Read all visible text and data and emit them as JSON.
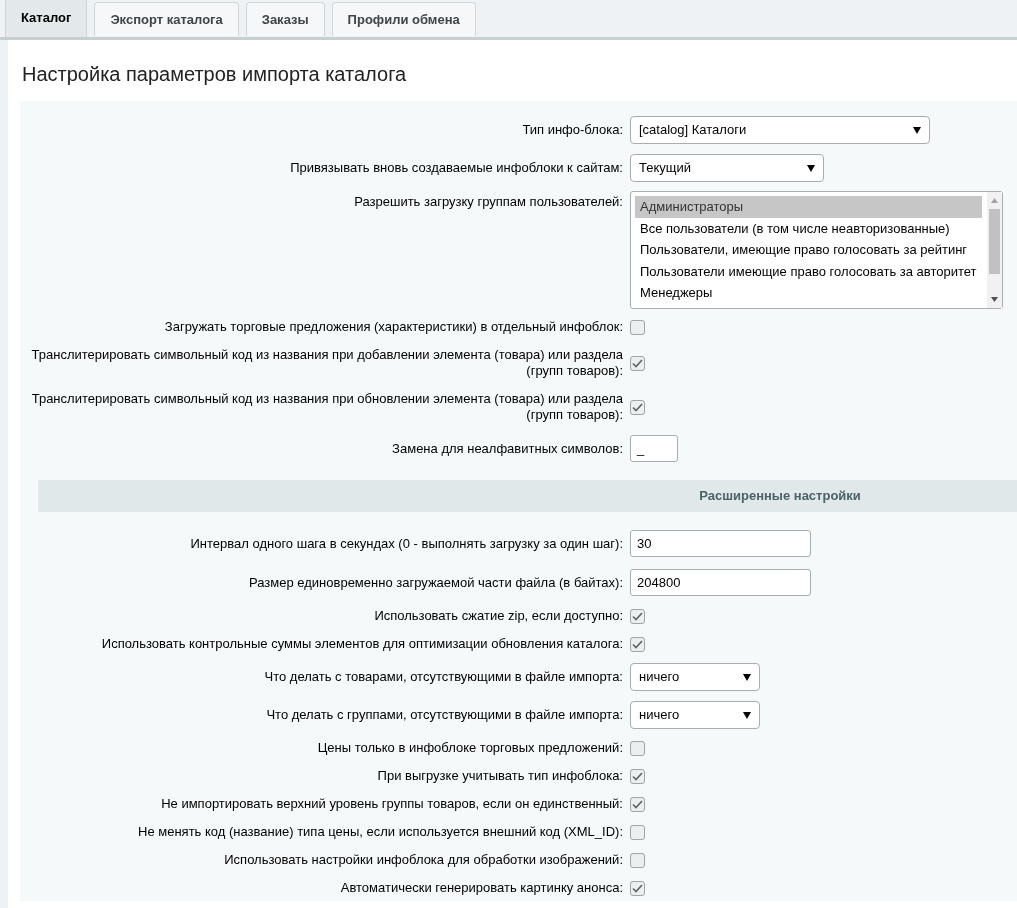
{
  "tabs": [
    {
      "label": "Каталог",
      "selected": true
    },
    {
      "label": "Экспорт каталога",
      "selected": false
    },
    {
      "label": "Заказы",
      "selected": false
    },
    {
      "label": "Профили обмена",
      "selected": false
    }
  ],
  "title": "Настройка параметров импорта каталога",
  "fields": [
    {
      "kind": "select",
      "label": "Тип инфо-блока:",
      "value": "[catalog] Каталоги"
    },
    {
      "kind": "select",
      "label": "Привязывать вновь создаваемые инфоблоки к сайтам:",
      "value": "Текущий"
    },
    {
      "kind": "listbox",
      "label": "Разрешить загрузку группам пользователей:",
      "options": [
        {
          "label": "Администраторы",
          "selected": true
        },
        {
          "label": "Все пользователи (в том числе неавторизованные)",
          "selected": false
        },
        {
          "label": "Пользователи, имеющие право голосовать за рейтинг",
          "selected": false
        },
        {
          "label": "Пользователи имеющие право голосовать за авторитет",
          "selected": false
        },
        {
          "label": "Менеджеры",
          "selected": false
        }
      ]
    },
    {
      "kind": "checkbox",
      "label": "Загружать торговые предложения (характеристики) в отдельный инфоблок:",
      "checked": false
    },
    {
      "kind": "checkbox",
      "label": "Транслитерировать символьный код из названия при добавлении элемента (товара) или раздела (групп товаров):",
      "checked": true
    },
    {
      "kind": "checkbox",
      "label": "Транслитерировать символьный код из названия при обновлении элемента (товара) или раздела (групп товаров):",
      "checked": true
    },
    {
      "kind": "text",
      "label": "Замена для неалфавитных символов:",
      "value": "_"
    },
    {
      "kind": "heading",
      "label": "Расширенные настройки"
    },
    {
      "kind": "text",
      "label": "Интервал одного шага в секундах (0 - выполнять загрузку за один шаг):",
      "value": "30"
    },
    {
      "kind": "text",
      "label": "Размер единовременно загружаемой части файла (в байтах):",
      "value": "204800"
    },
    {
      "kind": "checkbox",
      "label": "Использовать сжатие zip, если доступно:",
      "checked": true
    },
    {
      "kind": "checkbox",
      "label": "Использовать контрольные суммы элементов для оптимизации обновления каталога:",
      "checked": true
    },
    {
      "kind": "select",
      "label": "Что делать с товарами, отсутствующими в файле импорта:",
      "value": "ничего"
    },
    {
      "kind": "select",
      "label": "Что делать с группами, отсутствующими в файле импорта:",
      "value": "ничего"
    },
    {
      "kind": "checkbox",
      "label": "Цены только в инфоблоке торговых предложений:",
      "checked": false
    },
    {
      "kind": "checkbox",
      "label": "При выгрузке учитывать тип инфоблока:",
      "checked": true
    },
    {
      "kind": "checkbox",
      "label": "Не импортировать верхний уровень группы товаров, если он единственный:",
      "checked": true
    },
    {
      "kind": "checkbox",
      "label": "Не менять код (название) типа цены, если используется внешний код (XML_ID):",
      "checked": false
    },
    {
      "kind": "checkbox",
      "label": "Использовать настройки инфоблока для обработки изображений:",
      "checked": false
    },
    {
      "kind": "checkbox",
      "label": "Автоматически генерировать картинку анонса:",
      "checked": true
    }
  ]
}
